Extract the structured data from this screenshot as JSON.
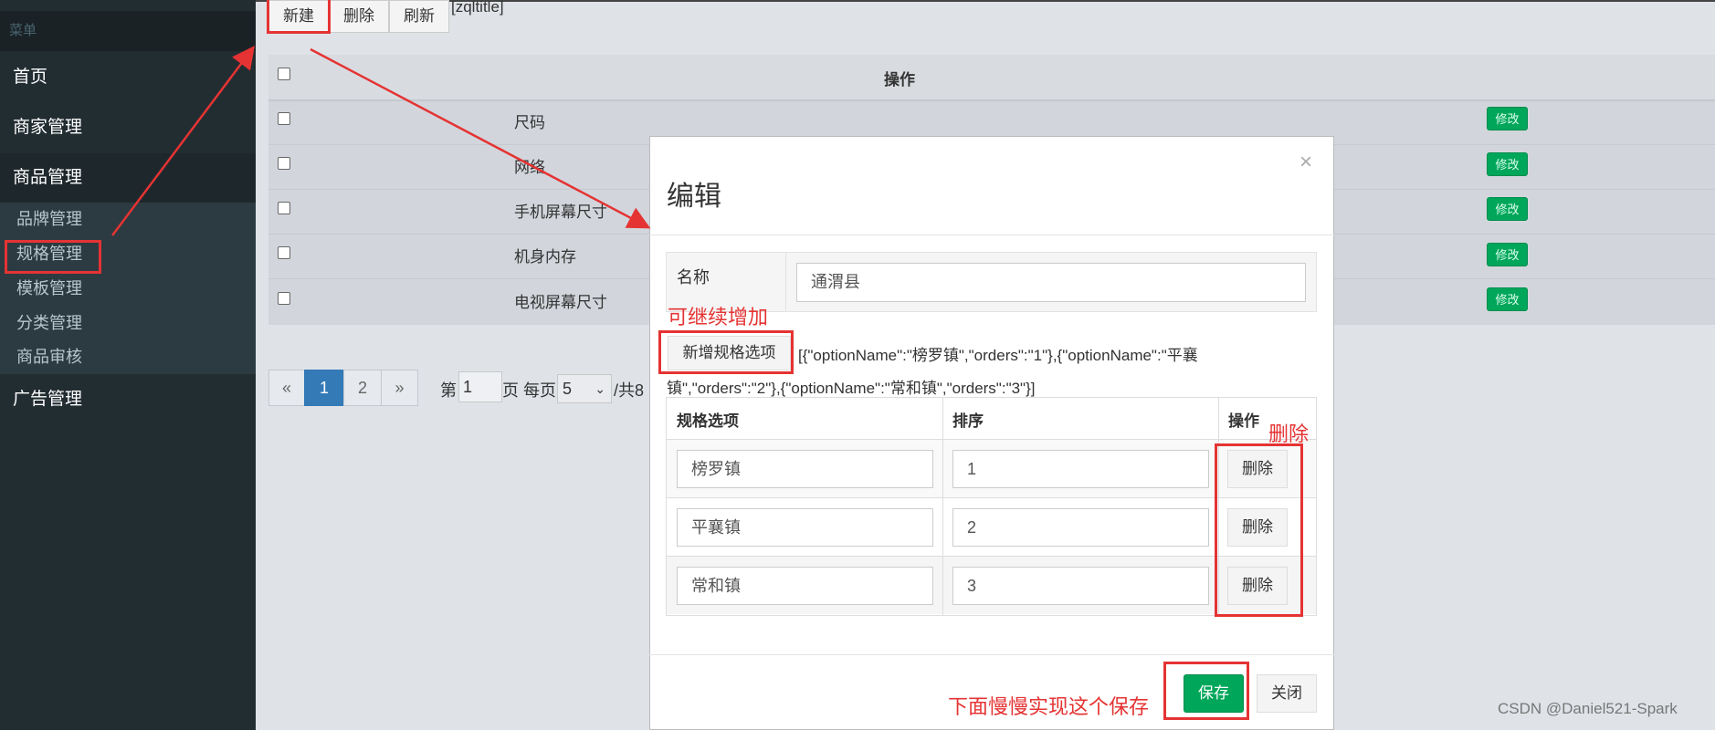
{
  "sidebar": {
    "header": "菜单",
    "items": [
      {
        "label": "首页"
      },
      {
        "label": "商家管理"
      },
      {
        "label": "商品管理"
      },
      {
        "label": "广告管理"
      }
    ],
    "subitems": [
      {
        "label": "品牌管理"
      },
      {
        "label": "规格管理"
      },
      {
        "label": "模板管理"
      },
      {
        "label": "分类管理"
      },
      {
        "label": "商品审核"
      }
    ]
  },
  "toolbar": {
    "new_label": "新建",
    "delete_label": "删除",
    "refresh_label": "刷新",
    "title_tag": "[zqltitle]"
  },
  "table": {
    "header_op": "操作",
    "rows": [
      {
        "name": "尺码",
        "action": "修改"
      },
      {
        "name": "网络",
        "action": "修改"
      },
      {
        "name": "手机屏幕尺寸",
        "action": "修改"
      },
      {
        "name": "机身内存",
        "action": "修改"
      },
      {
        "name": "电视屏幕尺寸",
        "action": "修改"
      }
    ]
  },
  "pagination": {
    "prev": "«",
    "pages": [
      "1",
      "2"
    ],
    "next": "»",
    "label_page": "第",
    "current_page": "1",
    "label_per_page": "页 每页",
    "per_page": "5",
    "label_total": "/共8"
  },
  "modal": {
    "title": "编辑",
    "close_glyph": "×",
    "name_label": "名称",
    "name_value": "通渭县",
    "add_option_label": "新增规格选项",
    "json_line1": "[{\"optionName\":\"榜罗镇\",\"orders\":\"1\"},{\"optionName\":\"平襄",
    "json_line2": "镇\",\"orders\":\"2\"},{\"optionName\":\"常和镇\",\"orders\":\"3\"}]",
    "columns": [
      "规格选项",
      "排序",
      "操作"
    ],
    "options": [
      {
        "name": "榜罗镇",
        "order": "1",
        "action": "删除"
      },
      {
        "name": "平襄镇",
        "order": "2",
        "action": "删除"
      },
      {
        "name": "常和镇",
        "order": "3",
        "action": "删除"
      }
    ],
    "save_label": "保存",
    "close_label": "关闭"
  },
  "annotations": {
    "continue_add": "可继续增加",
    "delete": "删除",
    "save_note": "下面慢慢实现这个保存"
  },
  "watermark": "CSDN @Daniel521-Spark",
  "colors": {
    "sidebar": "#222d32",
    "success": "#00a65a",
    "primary": "#337ab7",
    "annotation": "#e53333"
  }
}
